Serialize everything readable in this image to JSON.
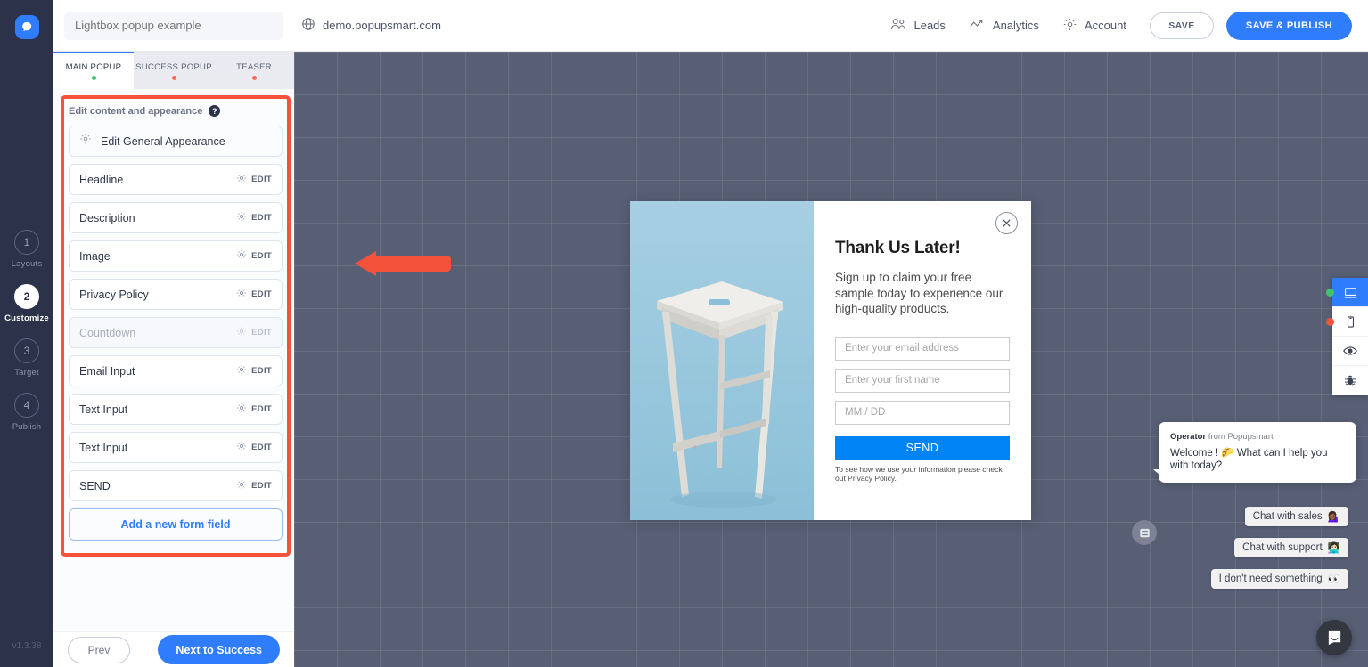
{
  "app": {
    "logo_icon": "popupsmart-logo-icon",
    "version": "v1.3.38"
  },
  "topbar": {
    "campaign_name_value": "Lightbox popup example",
    "campaign_name_placeholder": "Lightbox popup example",
    "globe_icon": "globe-icon",
    "domain": "demo.popupsmart.com",
    "links": [
      {
        "label": "Leads",
        "icon": "leads-icon"
      },
      {
        "label": "Analytics",
        "icon": "analytics-icon"
      },
      {
        "label": "Account",
        "icon": "gear-icon"
      }
    ],
    "save_label": "SAVE",
    "publish_label": "SAVE & PUBLISH"
  },
  "rail": {
    "steps": [
      {
        "number": "1",
        "label": "Layouts",
        "active": false
      },
      {
        "number": "2",
        "label": "Customize",
        "active": true
      },
      {
        "number": "3",
        "label": "Target",
        "active": false
      },
      {
        "number": "4",
        "label": "Publish",
        "active": false
      }
    ]
  },
  "tabs": [
    {
      "label": "MAIN POPUP",
      "active": true,
      "dot": "green"
    },
    {
      "label": "SUCCESS POPUP",
      "active": false,
      "dot": "red"
    },
    {
      "label": "TEASER",
      "active": false,
      "dot": "red"
    }
  ],
  "panel": {
    "heading": "Edit content and appearance",
    "help_icon": "help-icon",
    "general_label": "Edit General Appearance",
    "general_icon": "gear-icon",
    "edit_label": "EDIT",
    "fields": [
      {
        "label": "Headline",
        "disabled": false
      },
      {
        "label": "Description",
        "disabled": false
      },
      {
        "label": "Image",
        "disabled": false
      },
      {
        "label": "Privacy Policy",
        "disabled": false
      },
      {
        "label": "Countdown",
        "disabled": true
      },
      {
        "label": "Email Input",
        "disabled": false
      },
      {
        "label": "Text Input",
        "disabled": false
      },
      {
        "label": "Text Input",
        "disabled": false
      },
      {
        "label": "SEND",
        "disabled": false
      }
    ],
    "add_field_label": "Add a new form field",
    "prev_label": "Prev",
    "next_label": "Next to Success"
  },
  "canvas": {
    "annotation_arrow": "red-left-arrow",
    "popup": {
      "close_icon": "close-icon",
      "image_alt": "white-wooden-stool-on-blue-background",
      "title": "Thank Us Later!",
      "description": "Sign up to claim your free sample today to experience our high-quality products.",
      "inputs": [
        {
          "placeholder": "Enter your email address",
          "name": "email-field"
        },
        {
          "placeholder": "Enter your first name",
          "name": "first-name-field"
        },
        {
          "placeholder": "MM / DD",
          "name": "birthday-field"
        }
      ],
      "send_label": "SEND",
      "legal": "To see how we use your information please check out Privacy Policy."
    },
    "chat": {
      "operator": "Operator",
      "operator_suffix": " from Popupsmart",
      "message": "Welcome ! 🌮 What can I help you with today?",
      "replies": [
        {
          "label": "Chat with sales",
          "emoji": "💁🏾‍♀️"
        },
        {
          "label": "Chat with support",
          "emoji": "👩🏻‍💻"
        },
        {
          "label": "I don't need something",
          "emoji": "👀"
        }
      ],
      "launcher_icon": "chat-launcher-icon"
    },
    "devices": [
      {
        "icon": "desktop-icon",
        "active": true,
        "dot": "green"
      },
      {
        "icon": "mobile-icon",
        "active": false,
        "dot": "red"
      },
      {
        "icon": "eye-icon",
        "active": false,
        "dot": "none"
      },
      {
        "icon": "bug-icon",
        "active": false,
        "dot": "none"
      }
    ]
  },
  "colors": {
    "accent": "#2f7dfc",
    "rail_bg": "#2b3249",
    "canvas_bg": "#585f75",
    "annotation_red": "#f4523b",
    "status_green": "#3ec46d",
    "status_red": "#ff6d5a"
  }
}
